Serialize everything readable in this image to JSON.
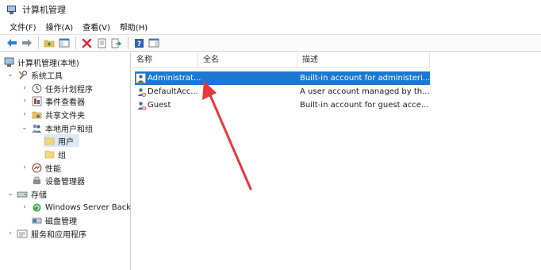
{
  "window": {
    "title": "计算机管理"
  },
  "menu": [
    "文件(F)",
    "操作(A)",
    "查看(V)",
    "帮助(H)"
  ],
  "toolbar": {
    "buttons": [
      "back-arrow-icon",
      "forward-arrow-icon",
      "up-folder-icon",
      "show-hide-tree-icon",
      "delete-icon",
      "properties-icon",
      "export-icon",
      "help-icon",
      "view-icon"
    ],
    "delete_color": "#d8262c"
  },
  "tree": {
    "root": "计算机管理(本地)",
    "system_tools": "系统工具",
    "task_scheduler": "任务计划程序",
    "event_viewer": "事件查看器",
    "shared_folders": "共享文件夹",
    "local_users_groups": "本地用户和组",
    "users": "用户",
    "groups": "组",
    "performance": "性能",
    "device_manager": "设备管理器",
    "storage": "存储",
    "windows_server_backup": "Windows Server Back",
    "disk_management": "磁盘管理",
    "services_apps": "服务和应用程序"
  },
  "list": {
    "columns": {
      "name": "名称",
      "full_name": "全名",
      "description": "描述"
    },
    "rows": [
      {
        "name": "Administrat...",
        "full_name": "",
        "description": "Built-in account for administeri...",
        "selected": true
      },
      {
        "name": "DefaultAcc...",
        "full_name": "",
        "description": "A user account managed by th...",
        "selected": false
      },
      {
        "name": "Guest",
        "full_name": "",
        "description": "Built-in account for guest acce...",
        "selected": false
      }
    ]
  },
  "colors": {
    "selection": "#1c78d4",
    "annotation_arrow": "#e8383d",
    "tree_selected": "#dbe8f6"
  }
}
